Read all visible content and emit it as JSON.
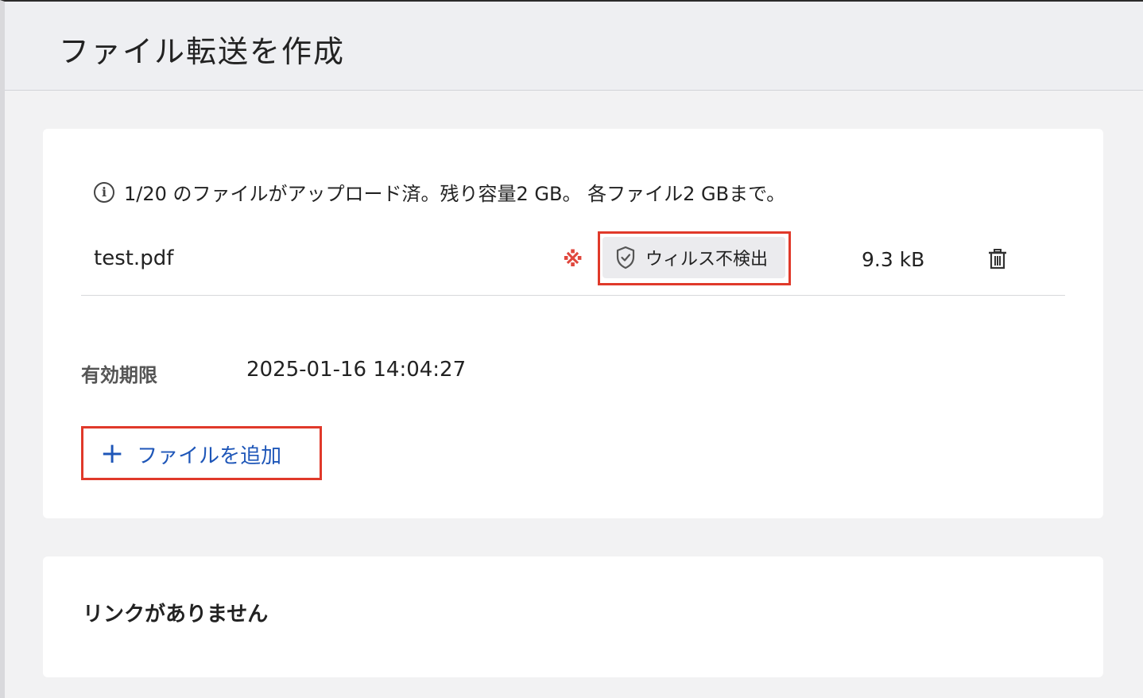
{
  "header": {
    "title": "ファイル転送を作成"
  },
  "upload": {
    "info_text": "1/20 のファイルがアップロード済。残り容量2 GB。 各ファイル2 GBまで。",
    "info_icon": "info-icon",
    "files": [
      {
        "name": "test.pdf",
        "required_mark": "※",
        "virus_status": "ウィルス不検出",
        "size": "9.3 kB",
        "delete_icon": "trash-icon"
      }
    ],
    "expiry_label": "有効期限",
    "expiry_value": "2025-01-16 14:04:27",
    "add_button_label": "ファイルを追加",
    "add_icon": "+"
  },
  "links": {
    "empty_text": "リンクがありません"
  },
  "colors": {
    "accent": "#1e56b8",
    "highlight_border": "#e0392a",
    "required_mark": "#e0463c"
  }
}
